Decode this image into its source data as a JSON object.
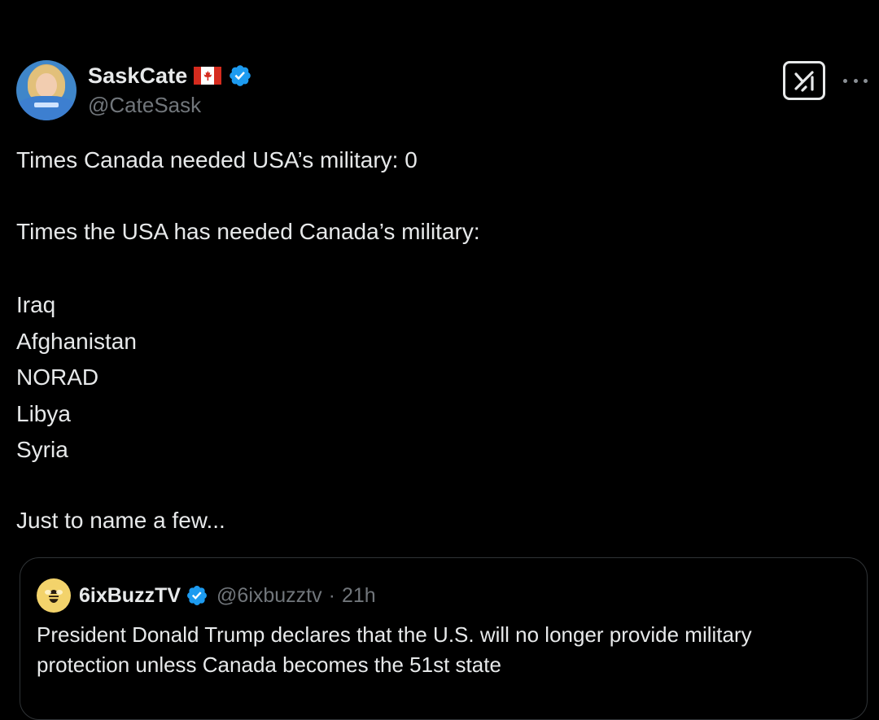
{
  "author": {
    "display_name": "SaskCate",
    "handle": "@CateSask",
    "flag_icon": "canada-flag-emoji",
    "verified": true,
    "verified_color": "#1d9bf0"
  },
  "actions": {
    "grok_icon": "grok-icon",
    "more_icon": "more-dots-icon"
  },
  "tweet": {
    "line1": "Times Canada needed USA’s military: 0",
    "line2": "Times the USA has needed Canada’s military:",
    "list": [
      "Iraq",
      "Afghanistan",
      "NORAD",
      "Libya",
      "Syria"
    ],
    "closing": "Just to name a few..."
  },
  "quoted_tweet": {
    "display_name": "6ixBuzzTV",
    "handle": "@6ixbuzztv",
    "separator": "·",
    "time": "21h",
    "text": "President Donald Trump declares that the U.S. will no longer provide military protection unless Canada becomes the 51st state",
    "avatar_color": "#f3d36b"
  },
  "colors": {
    "background": "#000000",
    "text": "#e7e9ea",
    "secondary_text": "#71767b",
    "border": "#2f3336"
  }
}
